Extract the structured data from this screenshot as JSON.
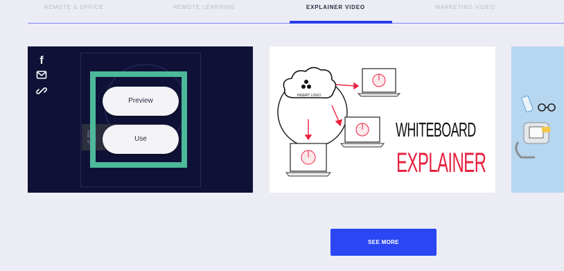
{
  "tabs": [
    {
      "label": "REMOTE & OFFICE",
      "active": false
    },
    {
      "label": "REMOTE LEARNING",
      "active": false
    },
    {
      "label": "EXPLAINER VIDEO",
      "active": true
    },
    {
      "label": "MARKETING VIDEO",
      "active": false
    }
  ],
  "card1": {
    "share_icons": [
      "facebook-icon",
      "mail-icon",
      "link-icon"
    ],
    "facebook_glyph": "f",
    "preview_label": "Preview",
    "use_label": "Use",
    "highlight_color": "#4db89a",
    "background_color": "#0f1236"
  },
  "card2": {
    "logo_text": "INSERT LOGO",
    "title_line1": "WHITEBOARD",
    "title_line2": "EXPLAINER",
    "title_line2_color": "#e8213f"
  },
  "card3": {
    "background_color": "#b7d6ef"
  },
  "see_more_label": "SEE MORE",
  "accent_color": "#2a47f3"
}
